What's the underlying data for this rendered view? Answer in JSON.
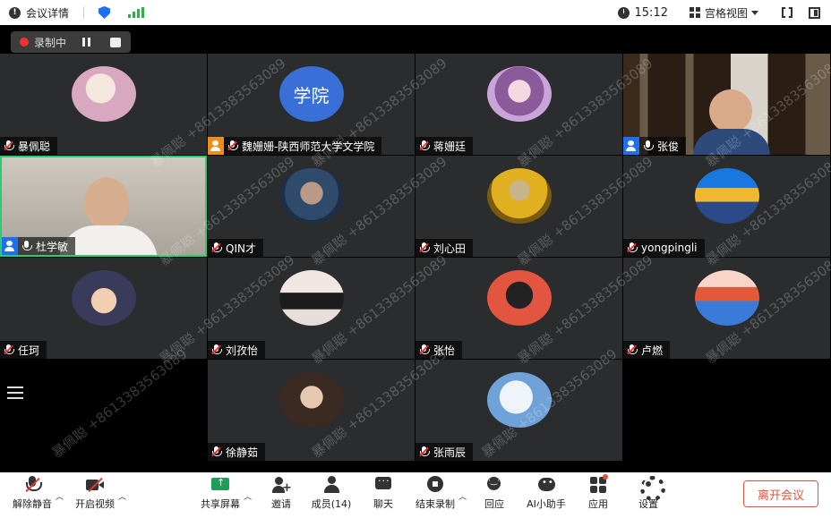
{
  "topbar": {
    "meeting_info_label": "会议详情",
    "time": "15:12",
    "view_mode": "宫格视图"
  },
  "recording": {
    "label": "录制中"
  },
  "tiles": [
    {
      "name": "暴佩聪",
      "col": 0,
      "row": 0,
      "avatar": "avatar-blue-face",
      "muted": true,
      "role": "none"
    },
    {
      "name": "魏姗姗-陕西师范大学文学院",
      "col": 1,
      "row": 0,
      "avatar": "avatar-text",
      "avatar_text": "学院",
      "muted": true,
      "role": "cohost"
    },
    {
      "name": "蒋姗廷",
      "col": 2,
      "row": 0,
      "avatar": "avatar-anime-girl",
      "muted": true,
      "role": "none"
    },
    {
      "name": "张俊",
      "col": 3,
      "row": 0,
      "avatar": "video-library",
      "muted": false,
      "role": "host"
    },
    {
      "name": "杜学敏",
      "col": 0,
      "row": 1,
      "avatar": "video-man",
      "muted": false,
      "role": "host",
      "active": true
    },
    {
      "name": "QIN才",
      "col": 1,
      "row": 1,
      "avatar": "avatar-smoking-man",
      "muted": true,
      "role": "none"
    },
    {
      "name": "刘心田",
      "col": 2,
      "row": 1,
      "avatar": "avatar-dog-flowers",
      "muted": true,
      "role": "none"
    },
    {
      "name": "yongpingli",
      "col": 3,
      "row": 1,
      "avatar": "avatar-tree-blue-sky",
      "muted": true,
      "role": "none"
    },
    {
      "name": "任珂",
      "col": 0,
      "row": 2,
      "avatar": "avatar-child-hat",
      "muted": true,
      "role": "none"
    },
    {
      "name": "刘孜怡",
      "col": 1,
      "row": 2,
      "avatar": "avatar-girl-sitting",
      "muted": true,
      "role": "none"
    },
    {
      "name": "张怡",
      "col": 2,
      "row": 2,
      "avatar": "avatar-red-cartoon",
      "muted": true,
      "role": "none"
    },
    {
      "name": "卢燃",
      "col": 3,
      "row": 2,
      "avatar": "avatar-sunset-sea",
      "muted": true,
      "role": "none"
    },
    {
      "name": "徐静茹",
      "col": 1,
      "row": 3,
      "avatar": "avatar-girl-hat",
      "muted": true,
      "role": "none"
    },
    {
      "name": "张雨辰",
      "col": 2,
      "row": 3,
      "avatar": "avatar-sky-clouds",
      "muted": true,
      "role": "none"
    }
  ],
  "watermark": {
    "name": "暴佩聪",
    "phone": "+8613383563089"
  },
  "toolbar": {
    "unmute": "解除静音",
    "start_video": "开启视频",
    "share_screen": "共享屏幕",
    "invite": "邀请",
    "members": "成员(14)",
    "chat": "聊天",
    "stop_recording": "结束录制",
    "reactions": "回应",
    "ai_assistant": "AI小助手",
    "apps": "应用",
    "settings": "设置",
    "leave": "离开会议"
  },
  "colors": {
    "accent_blue": "#1f6ff2",
    "cohost_orange": "#f08c1a",
    "record_red": "#e33333",
    "active_green": "#2ecc71",
    "leave_red": "#e8503a",
    "tile_bg": "#2b2c2e"
  }
}
